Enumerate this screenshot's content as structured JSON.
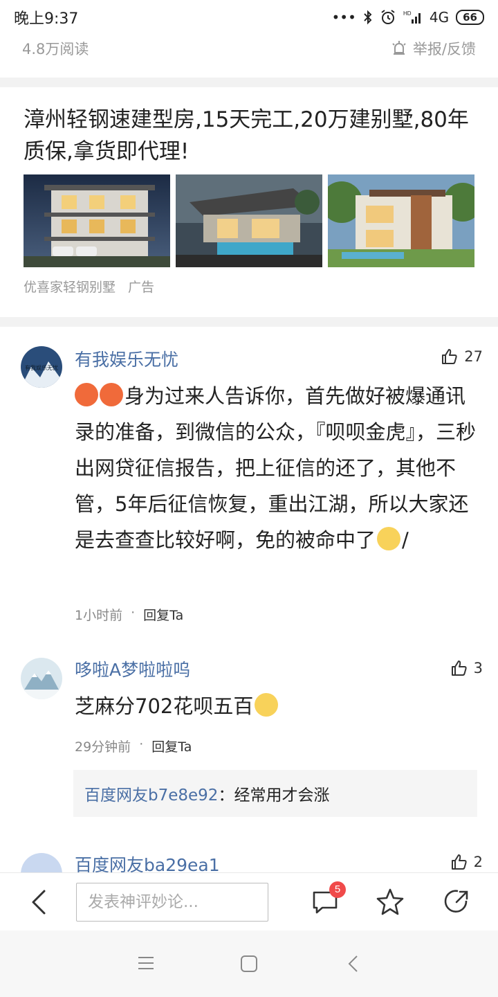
{
  "status_bar": {
    "time": "晚上9:37",
    "network": "4G",
    "battery": "66"
  },
  "article_meta": {
    "reads": "4.8万阅读",
    "report_label": "举报/反馈"
  },
  "ad": {
    "title": "漳州轻钢速建型房,15天完工,20万建别墅,80年质保,拿货即代理!",
    "advertiser": "优喜家轻钢别墅",
    "ad_label": "广告",
    "images": [
      "villa-photo-1",
      "villa-photo-2",
      "villa-photo-3"
    ]
  },
  "comments": [
    {
      "author": "有我娱乐无忧",
      "avatar_text": "有我娱乐无忧",
      "likes": "27",
      "text": "身为过来人告诉你，首先做好被爆通讯录的准备，到微信的公众，『呗呗金虎』，三秒出网贷征信报告，把上征信的还了，其他不管，5年后征信恢复，重出江湖，所以大家还是去查查比较好啊，免的被命中了",
      "text_suffix": "/",
      "time": "1小时前",
      "reply_label": "回复Ta"
    },
    {
      "author": "哆啦A梦啦啦呜",
      "likes": "3",
      "text": "芝麻分702花呗五百",
      "time": "29分钟前",
      "reply_label": "回复Ta",
      "sub_reply": {
        "user": "百度网友b7e8e92",
        "text": "：经常用才会涨"
      }
    },
    {
      "author": "百度网友ba29ea1",
      "likes": "2"
    }
  ],
  "bottom_bar": {
    "input_placeholder": "发表神评妙论...",
    "comment_badge": "5"
  },
  "colors": {
    "link_blue": "#4a6fa5",
    "badge_red": "#f04a4a",
    "divider_gray": "#f2f2f2"
  }
}
